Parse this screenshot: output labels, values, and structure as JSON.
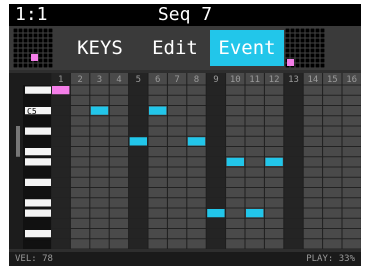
{
  "header": {
    "position": "1:1",
    "title": "Seq 7"
  },
  "tabs": [
    {
      "label": "KEYS",
      "active": false
    },
    {
      "label": "Edit",
      "active": false
    },
    {
      "label": "Event",
      "active": true
    }
  ],
  "piano": {
    "octave_label": "C5"
  },
  "steps": [
    "1",
    "2",
    "3",
    "4",
    "5",
    "6",
    "7",
    "8",
    "9",
    "10",
    "11",
    "12",
    "13",
    "14",
    "15",
    "16"
  ],
  "notes": [
    {
      "step": 1,
      "row": 0,
      "color": "#f47ee8"
    },
    {
      "step": 3,
      "row": 2,
      "color": "#22c6ea"
    },
    {
      "step": 6,
      "row": 2,
      "color": "#22c6ea"
    },
    {
      "step": 5,
      "row": 5,
      "color": "#22c6ea"
    },
    {
      "step": 8,
      "row": 5,
      "color": "#22c6ea"
    },
    {
      "step": 10,
      "row": 7,
      "color": "#22c6ea"
    },
    {
      "step": 12,
      "row": 7,
      "color": "#22c6ea"
    },
    {
      "step": 9,
      "row": 12,
      "color": "#22c6ea"
    },
    {
      "step": 11,
      "row": 12,
      "color": "#22c6ea"
    }
  ],
  "status": {
    "velocity": "VEL: 78",
    "play": "PLAY: 33%"
  },
  "colors": {
    "accent": "#22c6ea",
    "cursor": "#f47ee8"
  }
}
